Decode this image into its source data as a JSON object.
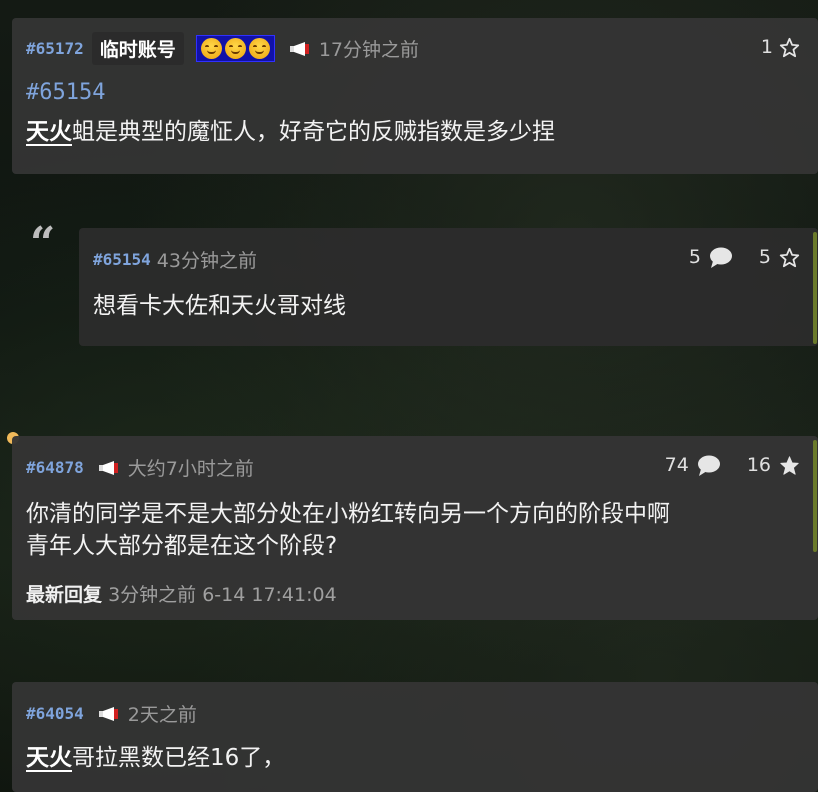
{
  "posts": [
    {
      "pid": "#65172",
      "name_tag": "临时账号",
      "time": "17分钟之前",
      "likes": "1",
      "ref": "#65154",
      "text_tag": "天火",
      "text_rest": "蛆是典型的魔怔人，好奇它的反贼指数是多少捏"
    },
    {
      "pid": "#65154",
      "time": "43分钟之前",
      "comments": "5",
      "likes": "5",
      "text": "想看卡大佐和天火哥对线"
    },
    {
      "pid": "#64878",
      "time": "大约7小时之前",
      "comments": "74",
      "likes": "16",
      "text_line1": "你清的同学是不是大部分处在小粉红转向另一个方向的阶段中啊",
      "text_line2": "青年人大部分都是在这个阶段?",
      "latest_label": "最新回复",
      "latest_time": "3分钟之前 6-14 17:41:04"
    },
    {
      "pid": "#64054",
      "time": "2天之前",
      "text_tag": "天火",
      "text_rest": "哥拉黑数已经16了，"
    }
  ],
  "icons": {
    "quote": "“",
    "megaphone": "megaphone-icon",
    "star_outline": "star-outline-icon",
    "star_filled": "star-filled-icon",
    "comment": "comment-bubble-icon"
  },
  "colors": {
    "pid_blue": "#7fa4dc",
    "card_bg": "#343434",
    "accent_yellow": "#f0b95a",
    "emoji_box": "#1111a8"
  }
}
